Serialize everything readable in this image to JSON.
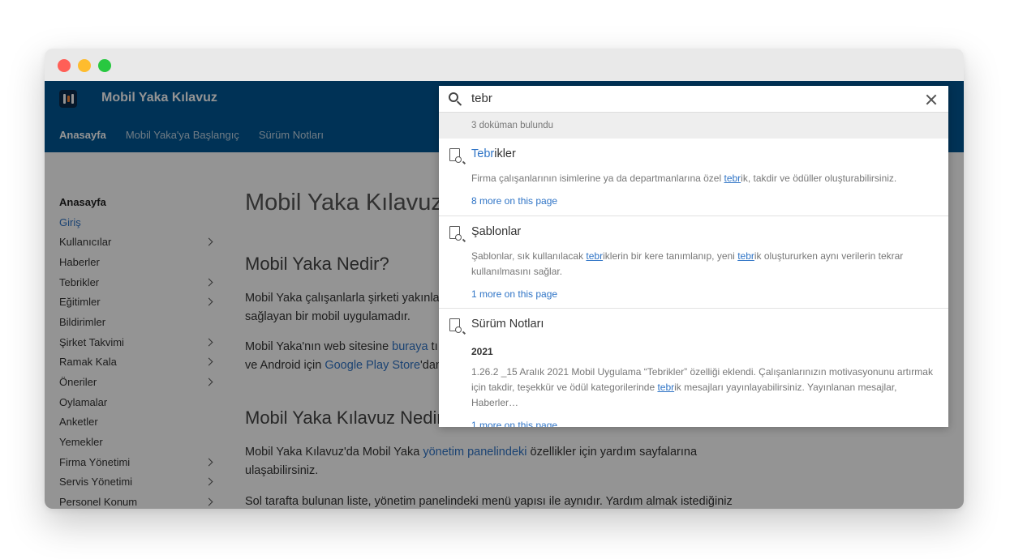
{
  "app": {
    "title": "Mobil Yaka Kılavuz"
  },
  "tabs": [
    "Anasayfa",
    "Mobil Yaka'ya Başlangıç",
    "Sürüm Notları"
  ],
  "sidebar": {
    "heading": "Anasayfa",
    "items": [
      {
        "label": "Giriş",
        "chevron": false,
        "active": true
      },
      {
        "label": "Kullanıcılar",
        "chevron": true
      },
      {
        "label": "Haberler",
        "chevron": false
      },
      {
        "label": "Tebrikler",
        "chevron": true
      },
      {
        "label": "Eğitimler",
        "chevron": true
      },
      {
        "label": "Bildirimler",
        "chevron": false
      },
      {
        "label": "Şirket Takvimi",
        "chevron": true
      },
      {
        "label": "Ramak Kala",
        "chevron": true
      },
      {
        "label": "Öneriler",
        "chevron": true
      },
      {
        "label": "Oylamalar",
        "chevron": false
      },
      {
        "label": "Anketler",
        "chevron": false
      },
      {
        "label": "Yemekler",
        "chevron": false
      },
      {
        "label": "Firma Yönetimi",
        "chevron": true
      },
      {
        "label": "Servis Yönetimi",
        "chevron": true
      },
      {
        "label": "Personel Konum",
        "chevron": true
      }
    ]
  },
  "content": {
    "title": "Mobil Yaka Kılavuz'",
    "h2_1": "Mobil Yaka Nedir?",
    "p1": "Mobil Yaka çalışanlarla şirketi yakınla",
    "p1b": "sağlayan bir mobil uygulamadır.",
    "p2_a": "Mobil Yaka'nın web sitesine ",
    "p2_link": "buraya",
    "p2_b": " tı",
    "p2_c": "ve Android için ",
    "p2_link2": "Google Play Store",
    "p2_d": "'dan",
    "h2_2": "Mobil Yaka Kılavuz Nedir",
    "p3_a": "Mobil Yaka Kılavuz'da Mobil Yaka ",
    "p3_link": "yönetim panelindeki",
    "p3_b": " özellikler için yardım sayfalarına",
    "p3_c": "ulaşabilirsiniz.",
    "p4": "Sol tarafta bulunan liste, yönetim panelindeki menü yapısı ile aynıdır. Yardım almak istediğiniz"
  },
  "search": {
    "query": "tebr",
    "count_text": "3 doküman bulundu",
    "results": [
      {
        "title_hl": "Tebr",
        "title_rest": "ikler",
        "desc_a": "Firma çalışanlarının isimlerine ya da departmanlarına özel ",
        "desc_u": "tebr",
        "desc_b": "ik, takdir ve ödüller oluşturabilirsiniz.",
        "more": "8 more on this page"
      },
      {
        "title": "Şablonlar",
        "desc_a": "Şablonlar, sık kullanılacak ",
        "desc_u": "tebr",
        "desc_b": "iklerin bir kere tanımlanıp, yeni ",
        "desc_u2": "tebr",
        "desc_c": "ik oluştururken aynı verilerin tekrar kullanılmasını sağlar.",
        "more": "1 more on this page"
      },
      {
        "title": "Sürüm Notları",
        "year": "2021",
        "desc_a": "1.26.2 _15 Aralık 2021 Mobil Uygulama “Tebrikler” özelliği eklendi. Çalışanlarınızın motivasyonunu artırmak için takdir, teşekkür ve ödül kategorilerinde ",
        "desc_u": "tebr",
        "desc_b": "ik mesajları yayınlayabilirsiniz. Yayınlanan mesajlar, Haberler…",
        "more": "1 more on this page"
      }
    ]
  }
}
